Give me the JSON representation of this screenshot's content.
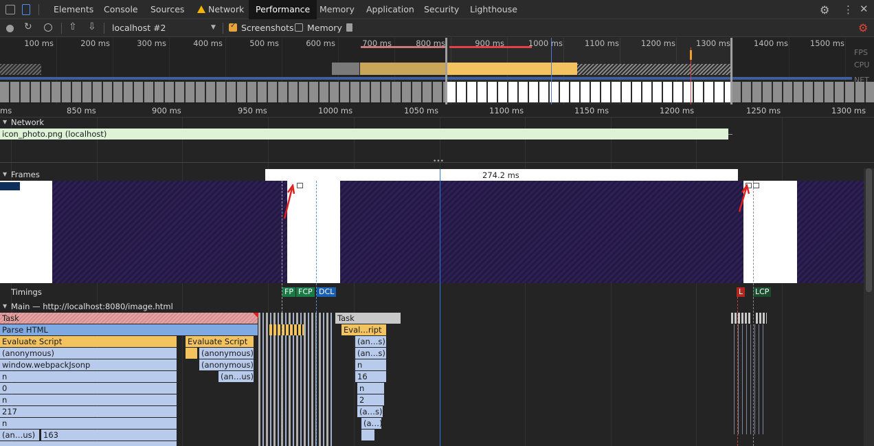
{
  "tabs": [
    {
      "label": "Elements",
      "active": false
    },
    {
      "label": "Console",
      "active": false
    },
    {
      "label": "Sources",
      "active": false
    },
    {
      "label": "Network",
      "active": false,
      "warning": true
    },
    {
      "label": "Performance",
      "active": true
    },
    {
      "label": "Memory",
      "active": false
    },
    {
      "label": "Application",
      "active": false
    },
    {
      "label": "Security",
      "active": false
    },
    {
      "label": "Lighthouse",
      "active": false
    }
  ],
  "toolbar": {
    "profile_select": "localhost #2",
    "screenshots_label": "Screenshots",
    "screenshots_checked": true,
    "memory_label": "Memory",
    "memory_checked": false
  },
  "overview": {
    "ticks": [
      "100 ms",
      "200 ms",
      "300 ms",
      "400 ms",
      "500 ms",
      "600 ms",
      "700 ms",
      "800 ms",
      "900 ms",
      "1000 ms",
      "1100 ms",
      "1200 ms",
      "1300 ms",
      "1400 ms",
      "1500 ms"
    ],
    "lanes": [
      "FPS",
      "CPU",
      "NET"
    ]
  },
  "ruler": {
    "ticks": [
      "ms",
      "850 ms",
      "900 ms",
      "950 ms",
      "1000 ms",
      "1050 ms",
      "1100 ms",
      "1150 ms",
      "1200 ms",
      "1250 ms",
      "1300 ms"
    ]
  },
  "network": {
    "header": "Network",
    "request": "icon_photo.png (localhost)"
  },
  "frames": {
    "header": "Frames",
    "duration": "274.2 ms"
  },
  "timings": {
    "header": "Timings",
    "markers": [
      "FP",
      "FCP",
      "DCL",
      "L",
      "LCP"
    ]
  },
  "main": {
    "header": "Main — http://localhost:8080/image.html",
    "col1": [
      "Task",
      "Parse HTML",
      "Evaluate Script",
      "(anonymous)",
      "window.webpackJsonp",
      "n",
      "0",
      "n",
      "217",
      "n",
      "(an…us)"
    ],
    "col1_extra": "163",
    "col2": [
      "Evaluate Script",
      "(anonymous)",
      "(anonymous)",
      "(an…us)"
    ],
    "col3": [
      "Task",
      "Eval…ript",
      "(an…s)",
      "(an…s)",
      "n",
      "16",
      "n",
      "2",
      "(a…s)",
      "(a…)"
    ]
  },
  "colors": {
    "accent": "#1a73e8",
    "record": "#e46962",
    "task": "#f2c35f",
    "parse": "#7fa9e2",
    "frame_idle": "#2a1d4e",
    "fp": "#1a7a45",
    "dcl": "#1a5fb4",
    "l": "#b3261e",
    "lcp": "#1a4d2e"
  }
}
